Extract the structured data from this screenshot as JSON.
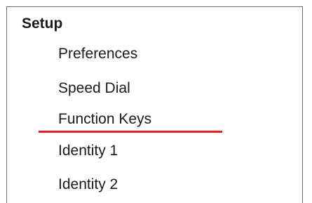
{
  "setup": {
    "title": "Setup",
    "items": [
      {
        "label": "Preferences"
      },
      {
        "label": "Speed Dial"
      },
      {
        "label": "Function Keys"
      },
      {
        "label": "Identity 1"
      },
      {
        "label": "Identity 2"
      }
    ]
  },
  "colors": {
    "highlight_underline": "#ea1c24",
    "panel_border": "#6b6b6b"
  }
}
